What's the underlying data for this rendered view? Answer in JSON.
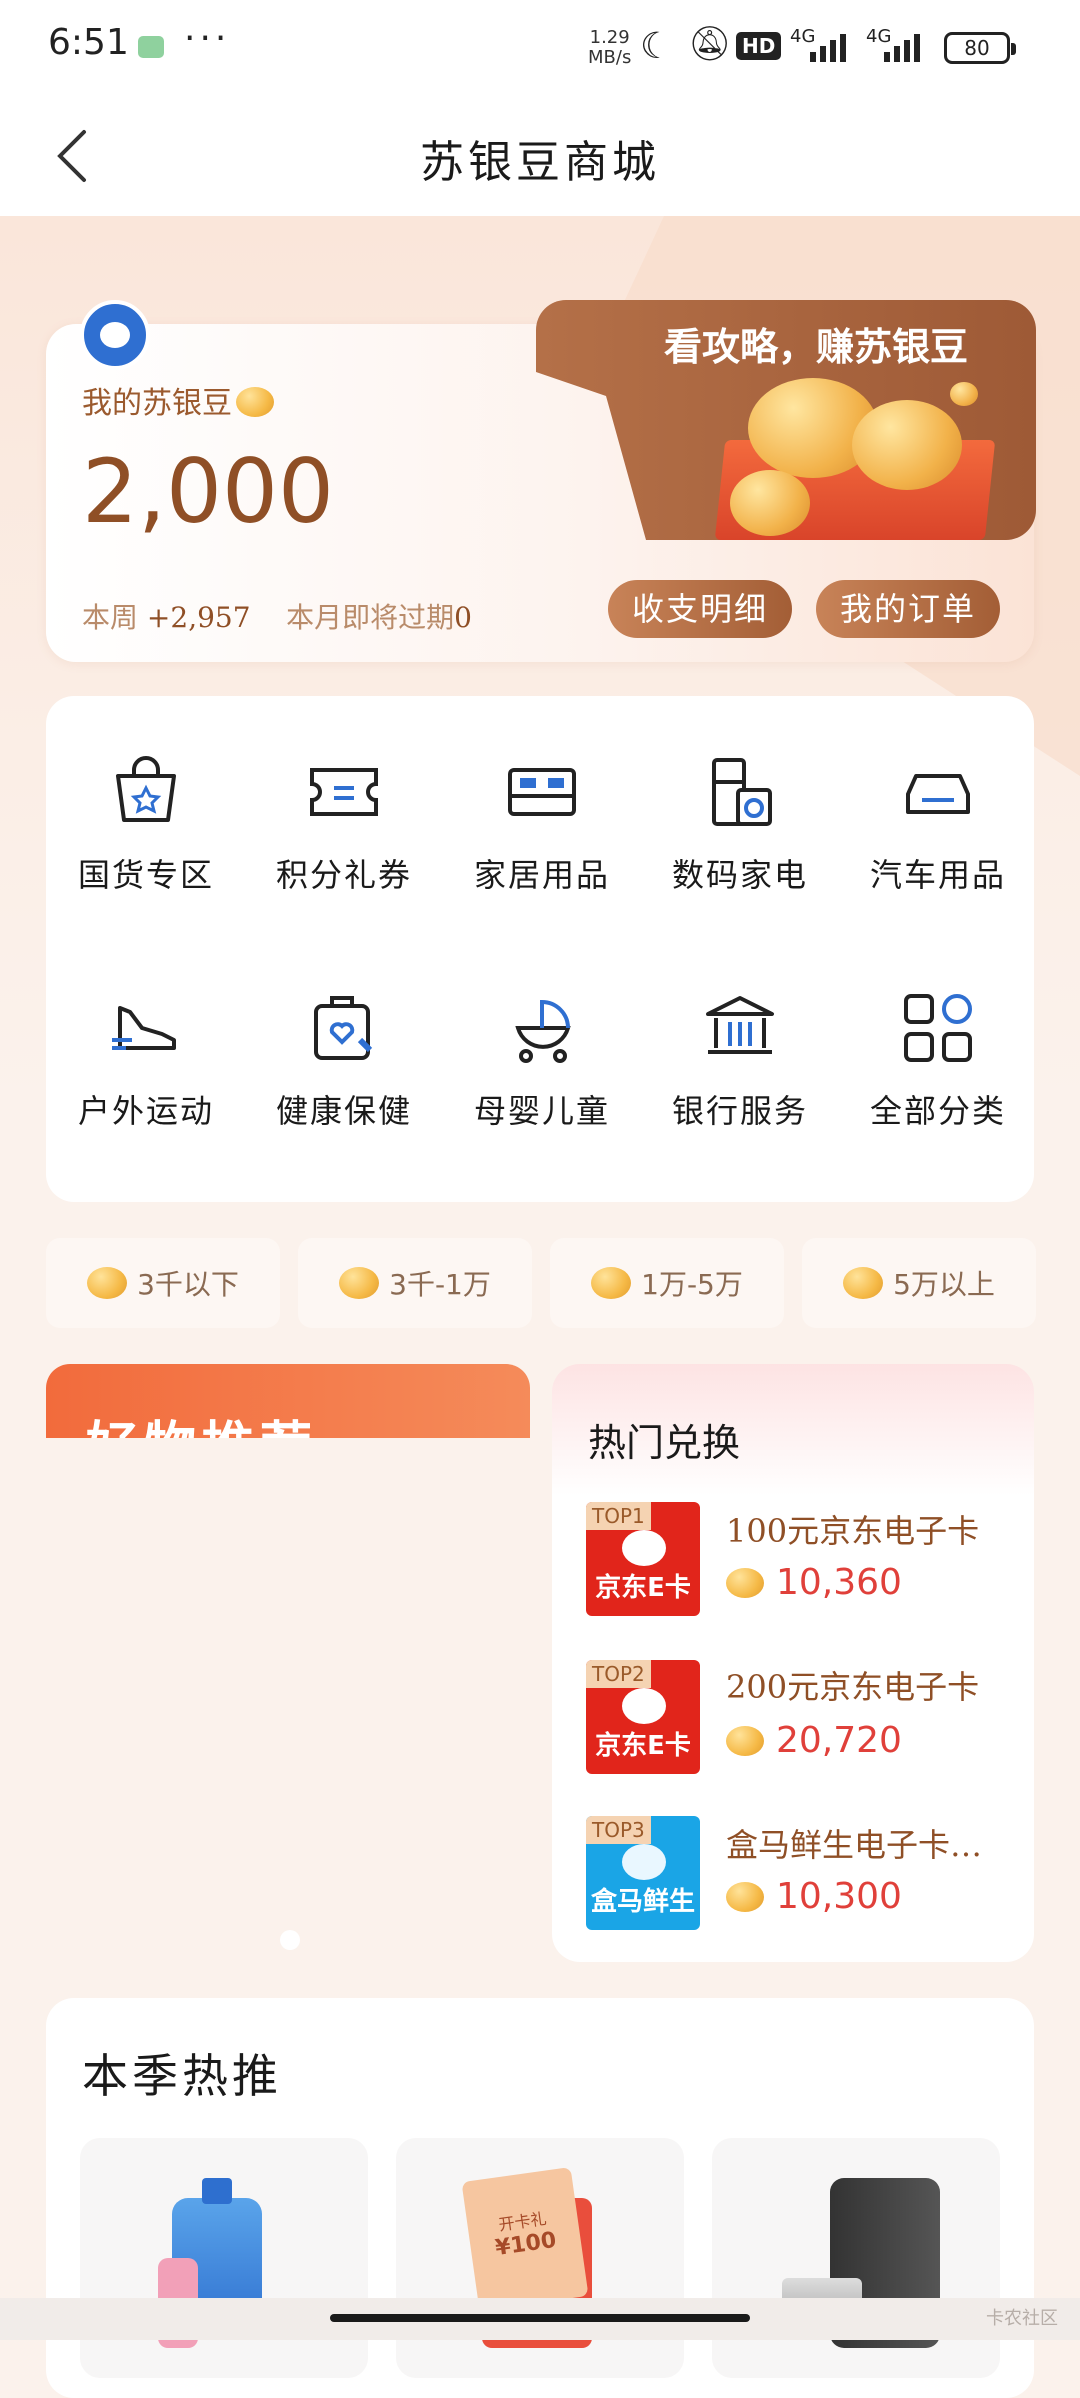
{
  "status_bar": {
    "time": "6:51",
    "dots": "···",
    "speed": "1.29",
    "speed_unit": "MB/s",
    "hd": "HD",
    "sig1": "4G",
    "sig2": "4G",
    "battery": "80"
  },
  "header": {
    "title": "苏银豆商城"
  },
  "account": {
    "label": "我的苏银豆",
    "balance": "2,000",
    "week_label": "本周",
    "week_value": "+2,957",
    "expire_label": "本月即将过期",
    "expire_value": "0",
    "promo": "看攻略，赚苏银豆",
    "btn_detail": "收支明细",
    "btn_orders": "我的订单"
  },
  "categories": [
    {
      "label": "国货专区",
      "icon": "bag-star-icon"
    },
    {
      "label": "积分礼券",
      "icon": "ticket-icon"
    },
    {
      "label": "家居用品",
      "icon": "bed-icon"
    },
    {
      "label": "数码家电",
      "icon": "appliance-icon"
    },
    {
      "label": "汽车用品",
      "icon": "car-icon"
    },
    {
      "label": "户外运动",
      "icon": "sneaker-icon"
    },
    {
      "label": "健康保健",
      "icon": "health-kit-icon"
    },
    {
      "label": "母婴儿童",
      "icon": "stroller-icon"
    },
    {
      "label": "银行服务",
      "icon": "bank-icon"
    },
    {
      "label": "全部分类",
      "icon": "grid-icon"
    }
  ],
  "price_ranges": [
    "3千以下",
    "3千-1万",
    "1万-5万",
    "5万以上"
  ],
  "good_stuff": {
    "title": "好物推荐"
  },
  "hot_exchange": {
    "title": "热门兑换",
    "items": [
      {
        "rank": "TOP1",
        "card": "京东E卡",
        "name": "100元京东电子卡",
        "price": "10,360",
        "color": "#e1251b"
      },
      {
        "rank": "TOP2",
        "card": "京东E卡",
        "name": "200元京东电子卡",
        "price": "20,720",
        "color": "#e1251b"
      },
      {
        "rank": "TOP3",
        "card": "盒马鲜生",
        "name": "盒马鲜生电子卡…",
        "price": "10,300",
        "color": "#1aa5e6"
      }
    ]
  },
  "season": {
    "title": "本季热推",
    "gift_text": "开卡礼",
    "gift_amount": "¥100"
  },
  "watermark": "卡农社区"
}
